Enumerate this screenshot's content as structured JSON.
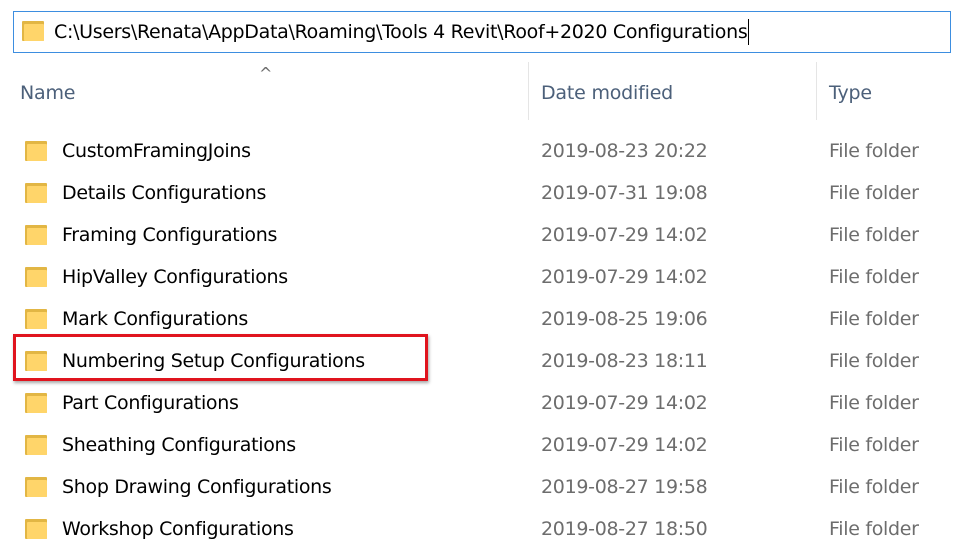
{
  "address_bar": {
    "path": "C:\\Users\\Renata\\AppData\\Roaming\\Tools 4 Revit\\Roof+2020 Configurations",
    "icon": "folder-icon"
  },
  "columns": {
    "name": "Name",
    "date_modified": "Date modified",
    "type": "Type",
    "sort_indicator": "^"
  },
  "files": [
    {
      "name": "CustomFramingJoins",
      "date": "2019-08-23 20:22",
      "type": "File folder",
      "icon": "folder-icon"
    },
    {
      "name": "Details Configurations",
      "date": "2019-07-31 19:08",
      "type": "File folder",
      "icon": "folder-icon"
    },
    {
      "name": "Framing Configurations",
      "date": "2019-07-29 14:02",
      "type": "File folder",
      "icon": "folder-icon"
    },
    {
      "name": "HipValley Configurations",
      "date": "2019-07-29 14:02",
      "type": "File folder",
      "icon": "folder-icon"
    },
    {
      "name": "Mark Configurations",
      "date": "2019-08-25 19:06",
      "type": "File folder",
      "icon": "folder-icon"
    },
    {
      "name": "Numbering Setup Configurations",
      "date": "2019-08-23 18:11",
      "type": "File folder",
      "icon": "folder-icon",
      "highlighted": true
    },
    {
      "name": "Part Configurations",
      "date": "2019-07-29 14:02",
      "type": "File folder",
      "icon": "folder-icon"
    },
    {
      "name": "Sheathing Configurations",
      "date": "2019-07-29 14:02",
      "type": "File folder",
      "icon": "folder-icon"
    },
    {
      "name": "Shop Drawing Configurations",
      "date": "2019-08-27 19:58",
      "type": "File folder",
      "icon": "folder-icon"
    },
    {
      "name": "Workshop Configurations",
      "date": "2019-08-27 18:50",
      "type": "File folder",
      "icon": "folder-icon"
    }
  ],
  "colors": {
    "highlight_border": "#e0141e",
    "folder": "#ffd56a",
    "header_text": "#4c607a",
    "address_border": "#3d8ee0"
  }
}
